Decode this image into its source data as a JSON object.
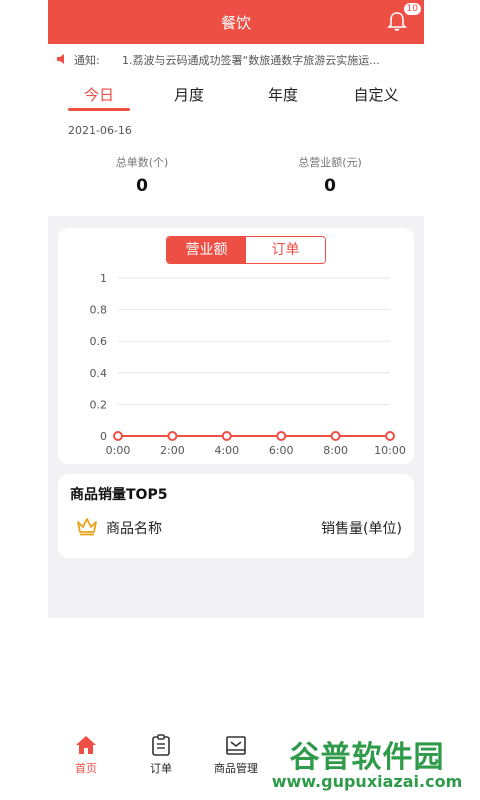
{
  "header": {
    "title": "餐饮",
    "badge_count": "10"
  },
  "notice": {
    "label": "通知:",
    "text": "1.荔波与云码通成功签署“数旅通数字旅游云实施运..."
  },
  "tabs": [
    {
      "label": "今日",
      "active": true
    },
    {
      "label": "月度",
      "active": false
    },
    {
      "label": "年度",
      "active": false
    },
    {
      "label": "自定义",
      "active": false
    }
  ],
  "summary": {
    "date": "2021-06-16",
    "orders_label": "总单数(个)",
    "orders_value": "0",
    "revenue_label": "总营业额(元)",
    "revenue_value": "0"
  },
  "toggle": {
    "revenue": "营业额",
    "orders": "订单"
  },
  "chart_data": {
    "type": "line",
    "x": [
      "0:00",
      "2:00",
      "4:00",
      "6:00",
      "8:00",
      "10:00"
    ],
    "series": [
      {
        "values": [
          0,
          0,
          0,
          0,
          0,
          0
        ]
      }
    ],
    "yticks": [
      "0",
      "0.2",
      "0.4",
      "0.6",
      "0.8",
      "1"
    ],
    "ylim": [
      0,
      1
    ],
    "grid": true,
    "color": "#ee4f44"
  },
  "top5": {
    "title": "商品销量TOP5",
    "col_name": "商品名称",
    "col_sales": "销售量(单位)"
  },
  "nav": [
    {
      "label": "首页",
      "active": true
    },
    {
      "label": "订单",
      "active": false
    },
    {
      "label": "商品管理",
      "active": false
    }
  ],
  "watermark": {
    "brand": "谷普软件园",
    "url": "www.gupuxiazai.com"
  }
}
